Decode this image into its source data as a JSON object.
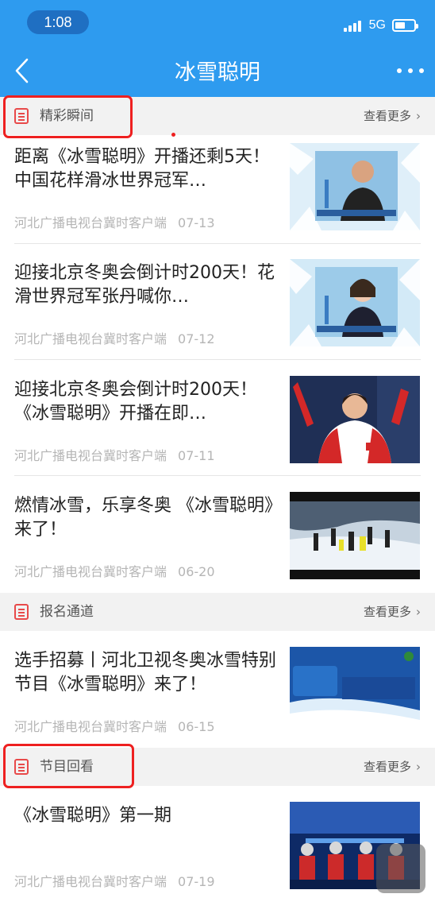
{
  "status_bar": {
    "time": "1:08",
    "network": "5G"
  },
  "header": {
    "title": "冰雪聪明"
  },
  "sections": [
    {
      "title": "精彩瞬间",
      "more": "查看更多"
    },
    {
      "title": "报名通道",
      "more": "查看更多"
    },
    {
      "title": "节目回看",
      "more": "查看更多"
    }
  ],
  "articles": [
    {
      "title": "距离《冰雪聪明》开播还剩5天！中国花样滑冰世界冠军…",
      "source": "河北广播电视台冀时客户端",
      "date": "07-13"
    },
    {
      "title": "迎接北京冬奥会倒计时200天！花滑世界冠军张丹喊你…",
      "source": "河北广播电视台冀时客户端",
      "date": "07-12"
    },
    {
      "title": "迎接北京冬奥会倒计时200天！《冰雪聪明》开播在即…",
      "source": "河北广播电视台冀时客户端",
      "date": "07-11"
    },
    {
      "title": "燃情冰雪，乐享冬奥 《冰雪聪明》来了！",
      "source": "河北广播电视台冀时客户端",
      "date": "06-20"
    },
    {
      "title": "选手招募丨河北卫视冬奥冰雪特别节目《冰雪聪明》来了！",
      "source": "河北广播电视台冀时客户端",
      "date": "06-15"
    },
    {
      "title": "《冰雪聪明》第一期",
      "source": "河北广播电视台冀时客户端",
      "date": "07-19"
    }
  ],
  "colors": {
    "header_bg": "#2e9bef",
    "accent_red": "#e84a4a",
    "section_bg": "#f2f2f2"
  }
}
